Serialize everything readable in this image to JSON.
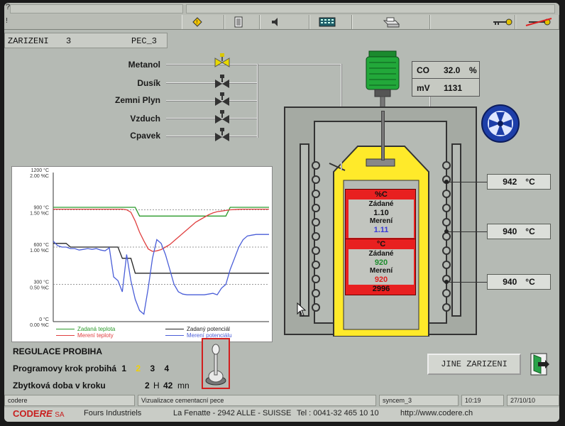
{
  "toolbar": {
    "icons": [
      "help-icon",
      "warning-icon",
      "exit-door-icon",
      "speaker-icon",
      "calculator-icon",
      "printer-icon",
      "key-icon",
      "key-crossed-icon"
    ]
  },
  "header": {
    "device_label": "ZARIZENI",
    "device_number": "3",
    "device_name": "PEC_3"
  },
  "gases": [
    {
      "label": "Metanol"
    },
    {
      "label": "Dusík"
    },
    {
      "label": "Zemni Plyn"
    },
    {
      "label": "Vzduch"
    },
    {
      "label": "Cpavek"
    }
  ],
  "analyzer": {
    "co_label": "CO",
    "co_value": "32.0",
    "co_unit": "%",
    "mv_label": "mV",
    "mv_value": "1131"
  },
  "zones": [
    {
      "value": "942",
      "unit": "°C"
    },
    {
      "value": "940",
      "unit": "°C"
    },
    {
      "value": "940",
      "unit": "°C"
    }
  ],
  "carbon_panel": {
    "header": "%C",
    "set_label": "Zádané",
    "set_value": "1.10",
    "meas_label": "Merení",
    "meas_value": "1.11"
  },
  "temp_panel": {
    "header": "°C",
    "set_label": "Zádané",
    "set_value": "920",
    "meas_label": "Merení",
    "meas_value": "920",
    "extra_value": "2996"
  },
  "chart_data": {
    "type": "line",
    "y_temp_ticks": [
      "1200 °C",
      "900 °C",
      "600 °C",
      "300 °C",
      "0 °C"
    ],
    "y_pot_ticks": [
      "2.00 %C",
      "1.50 %C",
      "1.00 %C",
      "0.50 %C",
      "0.00 %C"
    ],
    "temp_range": [
      0,
      1200
    ],
    "x": [
      0,
      2,
      4,
      6,
      8,
      10,
      12,
      14,
      16,
      18,
      20,
      22,
      24,
      26,
      28,
      30,
      32,
      34,
      36,
      38,
      40,
      42,
      44,
      46,
      48,
      50,
      52,
      54,
      56,
      58,
      60,
      62,
      64,
      66,
      68,
      70,
      72,
      74,
      76,
      78,
      80,
      82,
      84,
      86,
      88,
      90,
      92,
      94,
      96,
      98,
      100
    ],
    "series": [
      {
        "name": "Zadaná teplota",
        "color": "#2a9a2a",
        "values": [
          920,
          920,
          920,
          920,
          920,
          920,
          920,
          920,
          920,
          920,
          920,
          920,
          920,
          920,
          920,
          920,
          920,
          920,
          920,
          920,
          850,
          850,
          850,
          850,
          850,
          850,
          850,
          850,
          850,
          850,
          850,
          850,
          850,
          850,
          850,
          850,
          850,
          850,
          850,
          850,
          850,
          920,
          920,
          920,
          920,
          920,
          920,
          920,
          920,
          920,
          920
        ]
      },
      {
        "name": "Merení teploty",
        "color": "#e04040",
        "values": [
          905,
          905,
          905,
          905,
          905,
          905,
          905,
          905,
          905,
          905,
          905,
          905,
          905,
          905,
          905,
          905,
          905,
          900,
          880,
          810,
          720,
          650,
          585,
          565,
          570,
          580,
          600,
          620,
          650,
          680,
          710,
          740,
          770,
          800,
          820,
          840,
          860,
          875,
          885,
          890,
          895,
          900,
          902,
          904,
          905,
          905,
          905,
          905,
          905,
          905,
          905
        ]
      },
      {
        "name": "Zadaný potenciál",
        "color": "#222222",
        "values": [
          1.05,
          1.05,
          1.05,
          1.05,
          1.0,
          1.0,
          1.0,
          1.0,
          1.0,
          1.0,
          1.0,
          1.0,
          1.0,
          1.0,
          1.0,
          1.0,
          0.85,
          0.85,
          0.85,
          0.65,
          0.65,
          0.65,
          0.65,
          0.65,
          0.65,
          0.65,
          0.65,
          0.65,
          0.65,
          0.65,
          0.65,
          0.65,
          0.65,
          0.65,
          0.65,
          0.65,
          0.65,
          0.65,
          0.65,
          0.65,
          0.65,
          0.65,
          0.65,
          0.65,
          0.65,
          0.65,
          0.65,
          0.65,
          0.65,
          0.65,
          0.65
        ]
      },
      {
        "name": "Merení potenciálu",
        "color": "#4a5ed8",
        "values": [
          1.08,
          1.02,
          1.0,
          1.0,
          0.98,
          0.98,
          0.96,
          0.97,
          0.98,
          0.97,
          0.98,
          0.96,
          0.95,
          0.99,
          0.6,
          0.55,
          0.4,
          0.9,
          0.55,
          0.3,
          0.15,
          0.1,
          0.45,
          0.85,
          1.1,
          1.05,
          0.9,
          0.7,
          0.5,
          0.4,
          0.37,
          0.36,
          0.36,
          0.36,
          0.36,
          0.36,
          0.37,
          0.38,
          0.36,
          0.45,
          0.5,
          0.7,
          0.85,
          1.0,
          1.1,
          1.15,
          1.16,
          1.17,
          1.17,
          1.17,
          1.17
        ]
      }
    ]
  },
  "legend": {
    "set_temp": "Zadaná teplota",
    "meas_temp": "Merení teploty",
    "set_pot": "Zadaný potenciál",
    "meas_pot": "Merení potenciálu"
  },
  "regulation": {
    "status": "REGULACE PROBIHA",
    "step_label": "Programovy krok probihá",
    "steps": [
      "1",
      "2",
      "3",
      "4"
    ],
    "remaining_label": "Zbytková doba v kroku",
    "hours": "2",
    "h_unit": "H",
    "minutes": "42",
    "m_unit": "mn"
  },
  "buttons": {
    "other_device": "JINE ZARIZENI"
  },
  "status_bar": {
    "user": "codere",
    "screen_title": "Vizualizace cementacní pece",
    "station": "syncem_3",
    "time": "10:19",
    "date": "27/10/10"
  },
  "footer": {
    "brand_a": "CODE",
    "brand_b": "RE",
    "brand_sa": "SA",
    "company": "Fours Industriels",
    "address": "La Fenatte - 2942 ALLE - SUISSE",
    "phone": "Tel : 0041-32 465 10 10",
    "url": "http://www.codere.ch"
  },
  "colors": {
    "retort": "#ffea2a",
    "panel_red": "#e82020",
    "motor_green": "#22a83a",
    "fan_blue": "#1d3ea8"
  }
}
